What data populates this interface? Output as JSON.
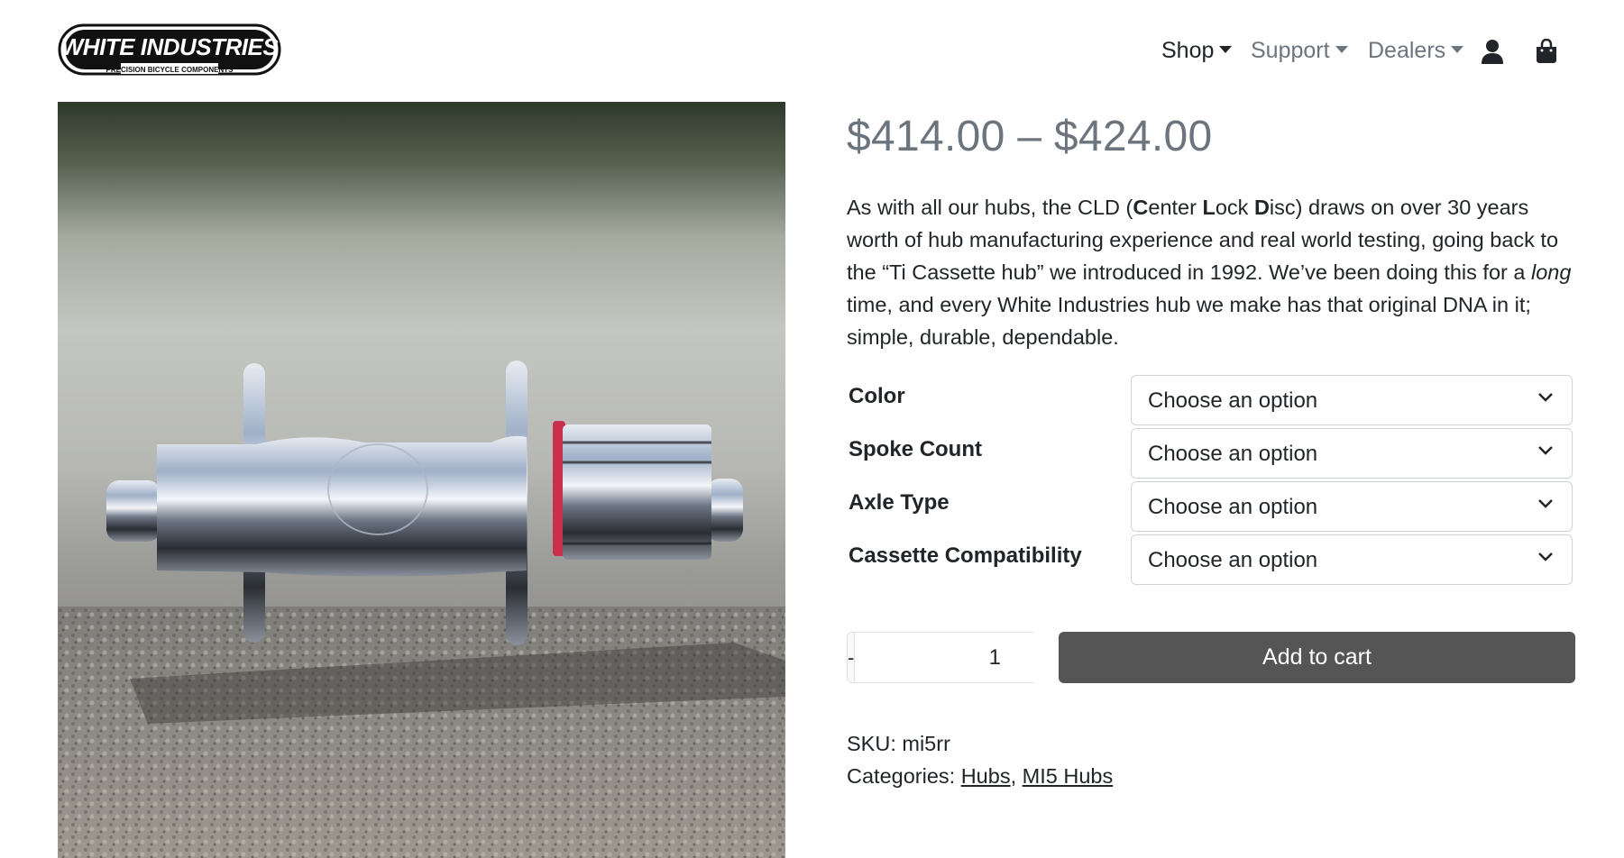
{
  "header": {
    "logo_text": "WHITE INDUSTRIES",
    "logo_tagline": "PRECISION BICYCLE COMPONENTS",
    "nav": [
      {
        "label": "Shop"
      },
      {
        "label": "Support"
      },
      {
        "label": "Dealers"
      }
    ],
    "icons": [
      "user-icon",
      "shopping-bag-icon"
    ]
  },
  "product": {
    "image_label": "MI5 hub",
    "price_range": "$414.00 – $424.00",
    "description": {
      "p1": "As with all our hubs, the CLD (",
      "c": "C",
      "enter": "enter ",
      "l": "L",
      "ock": "ock ",
      "d": "D",
      "p2": "isc) draws on over 30 years worth of hub manufacturing experience and real world testing, going back to the “Ti Cassette hub” we introduced in 1992.  We’ve been doing this for a ",
      "long": "long",
      "p3": " time, and every White Industries hub we make has that original DNA in it; simple, durable, dependable."
    },
    "variations": [
      {
        "label": "Color",
        "value": "Choose an option"
      },
      {
        "label": "Spoke Count",
        "value": "Choose an option"
      },
      {
        "label": "Axle Type",
        "value": "Choose an option"
      },
      {
        "label": "Cassette Compatibility",
        "value": "Choose an option"
      }
    ],
    "quantity": {
      "minus": "-",
      "value": "1",
      "plus": "+"
    },
    "add_to_cart": "Add to cart",
    "sku_label": "SKU: ",
    "sku": "mi5rr",
    "categories_label": "Categories: ",
    "categories": [
      "Hubs",
      "MI5 Hubs"
    ],
    "category_separator": ", "
  }
}
